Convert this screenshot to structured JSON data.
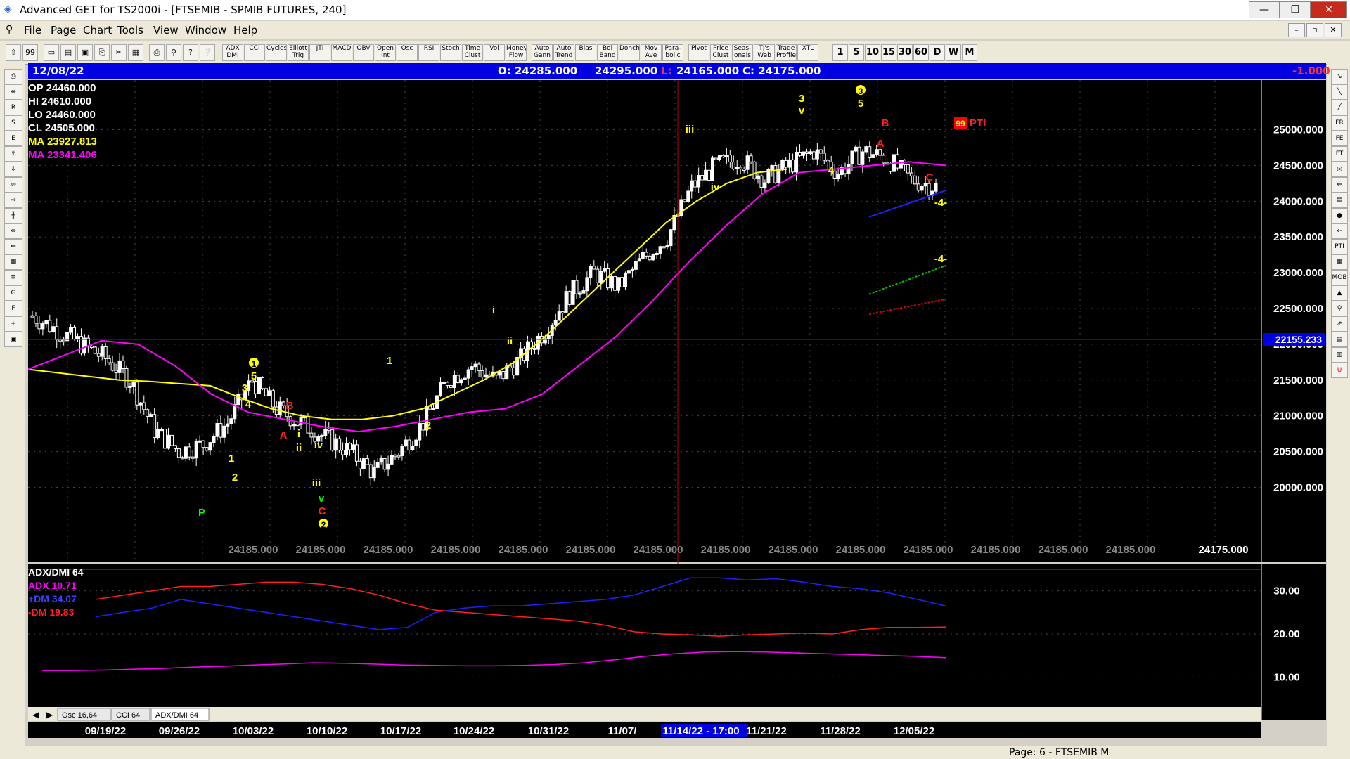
{
  "window": {
    "title": "Advanced GET for TS2000i - [FTSEMIB - SPMIB FUTURES, 240]",
    "min": "—",
    "max": "❐",
    "close": "✕"
  },
  "menu": [
    "File",
    "Page",
    "Chart",
    "Tools",
    "View",
    "Window",
    "Help"
  ],
  "toolbar": {
    "left_icons": [
      "pointer-icon",
      "quotes-icon",
      "new-icon",
      "open-icon",
      "save-icon",
      "copy-icon",
      "cut-icon",
      "grid-icon",
      "print-icon",
      "zoom-icon",
      "help-icon",
      "context-help-icon"
    ],
    "studies": [
      "ADX DMI",
      "CCI",
      "Cycles",
      "Elliott Trig",
      "JTI",
      "MACD",
      "OBV",
      "Open Int",
      "Osc",
      "RSI",
      "Stoch",
      "Time Clust",
      "Vol",
      "Money Flow",
      "Auto Gann",
      "Auto Trend",
      "Bias",
      "Bol Band",
      "Donch",
      "Mov Ave",
      "Para-bolic",
      "Pivot",
      "Price Clust",
      "Seas-onals",
      "TJ's Web",
      "Trade Profile",
      "XTL"
    ],
    "periods": [
      "1",
      "5",
      "10",
      "15",
      "30",
      "60",
      "D",
      "W",
      "M"
    ]
  },
  "info": {
    "date": "12/08/22",
    "open": "O: 24285.000",
    "high": "24295.000",
    "low_label": "L:",
    "low": "24165.000",
    "close": "C: 24175.000",
    "change": "-1.000"
  },
  "legend": {
    "op": "OP  24460.000",
    "hi": "HI   24610.000",
    "lo": "LO   24460.000",
    "cl": "CL   24505.000",
    "ma1": "MA  23927.813",
    "ma2": "MA  23341.406"
  },
  "colors": {
    "ma_fast": "#ffff00",
    "ma_slow": "#ff00ff",
    "plus_dm": "#2020ff",
    "minus_dm": "#ff2020",
    "adx": "#ff00ff",
    "info_bg": "#0000e0"
  },
  "price_axis": [
    "25000.000",
    "24500.000",
    "24000.000",
    "23500.000",
    "23000.000",
    "22500.000",
    "22000.000",
    "21500.000",
    "21000.000",
    "20500.000",
    "20000.000"
  ],
  "cursor_price": "22155.233",
  "bottom_values": [
    "24185.000",
    "24185.000",
    "24185.000",
    "24185.000",
    "24185.000",
    "24185.000",
    "24185.000",
    "24185.000",
    "24185.000",
    "24185.000",
    "24185.000",
    "24185.000",
    "24185.000",
    "24185.000",
    "24175.000"
  ],
  "pti": {
    "value": "99",
    "label": "PTI"
  },
  "waves": [
    {
      "t": "1",
      "c": "#ffff00",
      "circle": true
    },
    {
      "t": "5",
      "c": "#ffff00"
    },
    {
      "t": "3",
      "c": "#ffff00"
    },
    {
      "t": "4",
      "c": "#ffff00"
    },
    {
      "t": "P",
      "c": "#00ff00"
    },
    {
      "t": "1",
      "c": "#ffff00"
    },
    {
      "t": "2",
      "c": "#ffff00"
    },
    {
      "t": "B",
      "c": "#ff2020"
    },
    {
      "t": "A",
      "c": "#ff2020"
    },
    {
      "t": "i",
      "c": "#ffff00"
    },
    {
      "t": "ii",
      "c": "#ffff00"
    },
    {
      "t": "iv",
      "c": "#ffff00"
    },
    {
      "t": "iii",
      "c": "#ffff00"
    },
    {
      "t": "v",
      "c": "#00ff00"
    },
    {
      "t": "C",
      "c": "#ff2020"
    },
    {
      "t": "2",
      "c": "#ffff00",
      "circle": true
    },
    {
      "t": "1",
      "c": "#ffff00"
    },
    {
      "t": "2",
      "c": "#ffff00"
    },
    {
      "t": "i",
      "c": "#ffff00"
    },
    {
      "t": "ii",
      "c": "#ffff00"
    },
    {
      "t": "iii",
      "c": "#ffff00"
    },
    {
      "t": "iv",
      "c": "#ffff00"
    },
    {
      "t": "3",
      "c": "#ffff00"
    },
    {
      "t": "v",
      "c": "#ffff00"
    },
    {
      "t": "4",
      "c": "#ffff00"
    },
    {
      "t": "3",
      "c": "#ffff00",
      "circle": true
    },
    {
      "t": "5",
      "c": "#ffff00"
    },
    {
      "t": "B",
      "c": "#ff2020"
    },
    {
      "t": "A",
      "c": "#ff2020"
    },
    {
      "t": "C",
      "c": "#ff2020"
    },
    {
      "t": "-4-",
      "c": "#ffff00"
    },
    {
      "t": "-4-",
      "c": "#ffff00"
    }
  ],
  "indicator": {
    "title": "ADX/DMI 64",
    "adx": "ADX 10.71",
    "plus_dm": "+DM 34.07",
    "minus_dm": "-DM  19.83",
    "axis": [
      "30.00",
      "20.00",
      "10.00"
    ]
  },
  "tabs": [
    "Osc 16,64",
    "CCI 64",
    "ADX/DMI 64"
  ],
  "dates": [
    "09/19/22",
    "09/26/22",
    "10/03/22",
    "10/10/22",
    "10/17/22",
    "10/24/22",
    "10/31/22",
    "11/07/",
    "11/14/22 - 17:00",
    "11/21/22",
    "11/28/22",
    "12/05/22"
  ],
  "status": {
    "page": "Page: 6 - FTSEMIB M"
  },
  "chart_data": {
    "type": "candlestick",
    "ylim": [
      19700,
      25300
    ],
    "series": [
      {
        "name": "MA",
        "values": [
          21650,
          21600,
          21550,
          21500,
          21480,
          21450,
          21420,
          21250,
          21100,
          21000,
          20950,
          20950,
          21000,
          21100,
          21300,
          21500,
          21750,
          22100,
          22500,
          22900,
          23300,
          23700,
          24000,
          24250,
          24400,
          24450
        ]
      },
      {
        "name": "MA",
        "values": [
          21650,
          21850,
          22050,
          22000,
          21700,
          21300,
          21050,
          20950,
          20850,
          20780,
          20850,
          20950,
          21050,
          21100,
          21300,
          21700,
          22100,
          22600,
          23150,
          23650,
          24100,
          24400,
          24450,
          24500,
          24550,
          24500
        ]
      }
    ],
    "closes": [
      22400,
      22200,
      22000,
      21800,
      21500,
      20800,
      20500,
      20600,
      20900,
      21500,
      21100,
      20900,
      20700,
      20500,
      20200,
      20500,
      20900,
      21500,
      21700,
      21500,
      21800,
      22200,
      22700,
      23000,
      22800,
      23200,
      23500,
      24200,
      24500,
      24600,
      24300,
      24500,
      24700,
      24400,
      24700,
      24600,
      24300,
      24200
    ],
    "adx_series": [
      {
        "name": "+DM",
        "values": [
          24,
          25,
          26,
          28,
          27,
          26,
          25,
          24,
          23,
          22,
          21,
          21.5,
          25,
          26,
          26.5,
          26.5,
          27,
          27.5,
          28,
          29,
          31,
          33,
          33,
          32.5,
          32.8,
          32,
          31,
          30.5,
          29.5,
          28,
          26.5
        ]
      },
      {
        "name": "-DM",
        "values": [
          28,
          29,
          30,
          31,
          31,
          31.5,
          32,
          32,
          31.5,
          30.5,
          29,
          27,
          25.5,
          25,
          24.5,
          24,
          23.5,
          23,
          22,
          20.5,
          20,
          19.8,
          19.5,
          19.8,
          20,
          20.2,
          20,
          21,
          21.5,
          21.5,
          21.6
        ]
      },
      {
        "name": "ADX",
        "values": [
          11.5,
          11.5,
          11.6,
          11.8,
          12,
          12.3,
          12.5,
          12.8,
          13,
          13.3,
          13.2,
          13,
          12.8,
          12.7,
          12.6,
          12.6,
          12.7,
          12.9,
          13.3,
          14,
          14.8,
          15.4,
          15.8,
          15.9,
          15.8,
          15.6,
          15.4,
          15.2,
          15,
          14.8,
          14.5
        ]
      }
    ],
    "adx_ylim": [
      5,
      35
    ]
  }
}
